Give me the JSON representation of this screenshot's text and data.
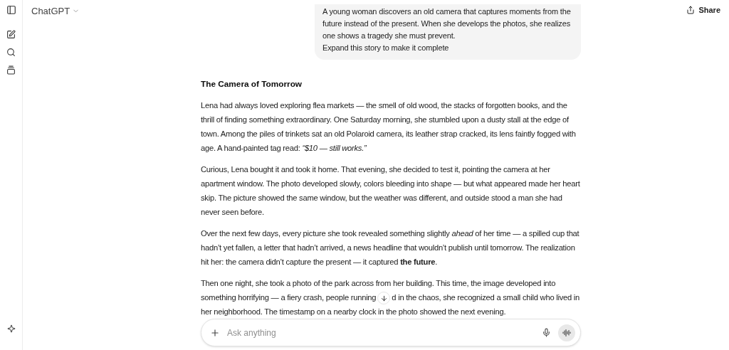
{
  "header": {
    "title": "ChatGPT",
    "share": "Share"
  },
  "user_message": {
    "lines": [
      "A young woman discovers an old camera that captures moments from the future instead of the present. When she develops the photos, she realizes one shows a tragedy she must prevent.",
      "Expand this story to make it complete"
    ]
  },
  "response": {
    "title": "The Camera of Tomorrow",
    "paragraphs": [
      {
        "text": "Lena had always loved exploring flea markets — the smell of old wood, the stacks of forgotten books, and the thrill of finding something extraordinary. One Saturday morning, she stumbled upon a dusty stall at the edge of town. Among the piles of trinkets sat an old Polaroid camera, its leather strap cracked, its lens faintly fogged with age. A hand-painted tag read: *“$10 — still works.”*"
      },
      {
        "text": "Curious, Lena bought it and took it home. That evening, she decided to test it, pointing the camera at her apartment window. The photo developed slowly, colors bleeding into shape — but what appeared made her heart skip. The picture showed the same window, but the weather was different, and outside stood a man she had never seen before."
      },
      {
        "text": "Over the next few days, every picture she took revealed something slightly *ahead* of her time — a spilled cup that hadn’t yet fallen, a letter that hadn’t arrived, a news headline that wouldn’t publish until tomorrow. The realization hit her: the camera didn’t capture the present — it captured **the future**."
      },
      {
        "text": "Then one night, she took a photo of the park across from her building. This time, the image developed into something horrifying — a fiery crash, people running",
        "text_after": "d in the chaos, she recognized a small child who lived in her neighborhood. The timestamp on a nearby clock in the photo showed the next evening."
      }
    ]
  },
  "composer": {
    "placeholder": "Ask anything"
  }
}
